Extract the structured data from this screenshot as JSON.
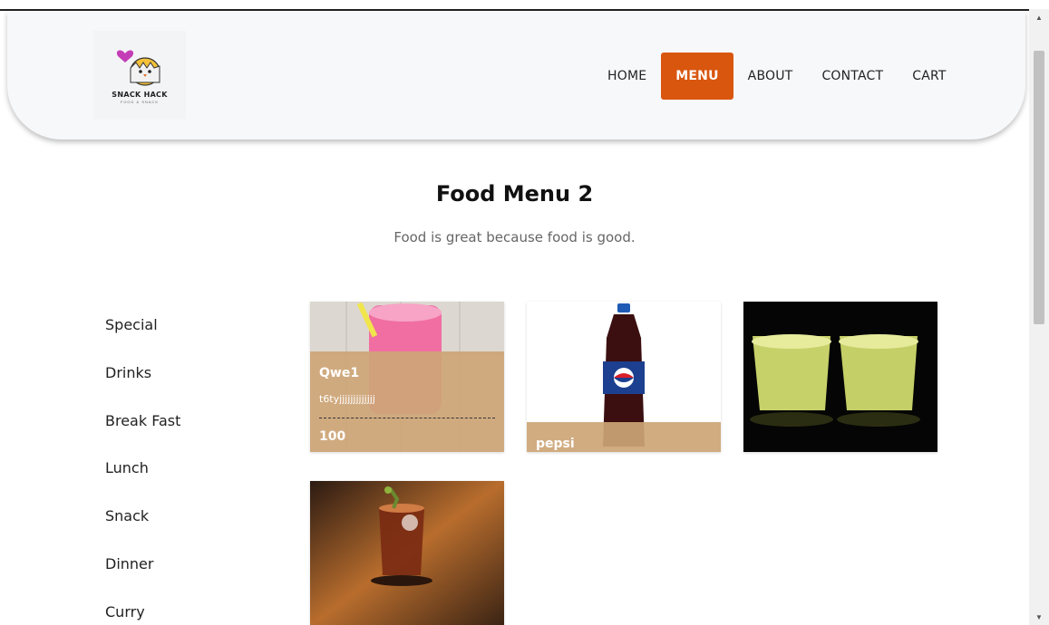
{
  "brand": {
    "name": "SNACK HACK",
    "tagline": "FOOD & SNACK"
  },
  "nav": {
    "items": [
      {
        "label": "HOME",
        "active": false
      },
      {
        "label": "MENU",
        "active": true
      },
      {
        "label": "ABOUT",
        "active": false
      },
      {
        "label": "CONTACT",
        "active": false
      },
      {
        "label": "CART",
        "active": false
      }
    ]
  },
  "main": {
    "title": "Food Menu 2",
    "subtitle": "Food is great because food is good."
  },
  "categories": [
    "Special",
    "Drinks",
    "Break Fast",
    "Lunch",
    "Snack",
    "Dinner",
    "Curry"
  ],
  "cards": [
    {
      "name": "Qwe1",
      "description": "t6tyjjjjjjjjjjjjj",
      "price": "100"
    },
    {
      "name": "pepsi",
      "description": "",
      "price": ""
    },
    {
      "name": "",
      "description": "",
      "price": ""
    },
    {
      "name": "",
      "description": "",
      "price": ""
    }
  ],
  "colors": {
    "accent": "#d9560f",
    "overlay": "#cda576"
  },
  "icons": {
    "scroll_up": "triangle-up",
    "scroll_down": "triangle-down"
  }
}
